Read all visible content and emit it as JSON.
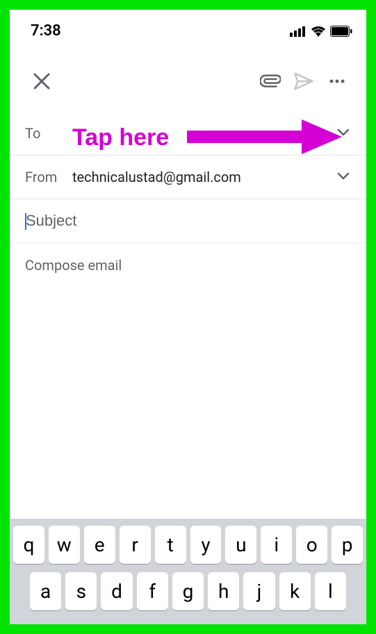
{
  "status": {
    "time": "7:38"
  },
  "compose": {
    "to_label": "To",
    "from_label": "From",
    "from_value": "technicalustad@gmail.com",
    "subject_placeholder": "Subject",
    "body_placeholder": "Compose email"
  },
  "annotation": {
    "text": "Tap here"
  },
  "keyboard": {
    "row1": [
      "q",
      "w",
      "e",
      "r",
      "t",
      "y",
      "u",
      "i",
      "o",
      "p"
    ],
    "row2": [
      "a",
      "s",
      "d",
      "f",
      "g",
      "h",
      "j",
      "k",
      "l"
    ]
  }
}
